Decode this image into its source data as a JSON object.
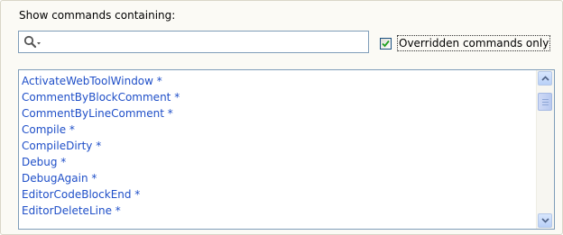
{
  "search": {
    "label": "Show commands containing:",
    "value": "",
    "icon": "search-icon"
  },
  "override_filter": {
    "label": "Overridden commands only",
    "checked": true
  },
  "commands": [
    "ActivateWebToolWindow *",
    "CommentByBlockComment *",
    "CommentByLineComment *",
    "Compile *",
    "CompileDirty *",
    "Debug *",
    "DebugAgain *",
    "EditorCodeBlockEnd *",
    "EditorDeleteLine *"
  ],
  "scrollbar": {
    "position_fraction": 0.05
  },
  "colors": {
    "command_text": "#1f4fc8",
    "border": "#7f9db9",
    "panel_bg": "#fbfaf5"
  }
}
